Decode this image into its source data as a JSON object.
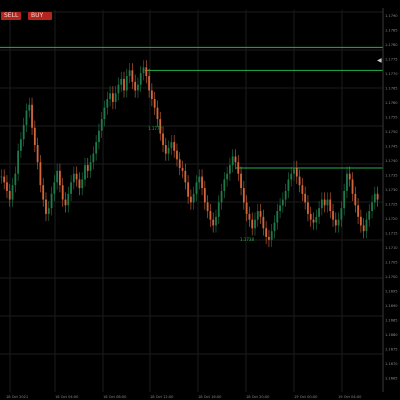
{
  "toolbar": {
    "sell_label": "SELL",
    "buy_label": "BUY"
  },
  "colors": {
    "background": "#000000",
    "grid": "#1b1b1b",
    "level_line": "#22b14c",
    "candle_up": "#1f7a4a",
    "candle_down": "#d4663a",
    "price_axis_text": "#8a8a8a",
    "button": "#b3261e"
  },
  "price_axis": {
    "ticks": [
      "1.1790",
      "1.1785",
      "1.1780",
      "1.1775",
      "1.1770",
      "1.1765",
      "1.1760",
      "1.1755",
      "1.1750",
      "1.1745",
      "1.1740",
      "1.1735",
      "1.1730",
      "1.1725",
      "1.1720",
      "1.1715",
      "1.1710",
      "1.1705",
      "1.1700",
      "1.1695",
      "1.1690",
      "1.1685",
      "1.1680",
      "1.1675",
      "1.1670",
      "1.1665"
    ],
    "current_price_marker": "◀"
  },
  "time_axis": {
    "ticks": [
      "18 Oct 2021",
      "18 Oct 04:00",
      "18 Oct 08:00",
      "18 Oct 12:00",
      "18 Oct 16:00",
      "18 Oct 20:00",
      "19 Oct 00:00",
      "19 Oct 04:00"
    ]
  },
  "level_labels": {
    "high_label": "1.1772",
    "mid_label": "1.1738"
  },
  "chart_data": {
    "type": "candlestick",
    "title": "",
    "xlabel": "",
    "ylabel": "",
    "ylim": [
      1.166,
      1.1793
    ],
    "grid": true,
    "closes": [
      1.1735,
      1.1733,
      1.173,
      1.1727,
      1.1732,
      1.1736,
      1.1744,
      1.1748,
      1.1753,
      1.1758,
      1.176,
      1.1752,
      1.1746,
      1.174,
      1.1732,
      1.1727,
      1.1722,
      1.1724,
      1.1729,
      1.1733,
      1.1737,
      1.1732,
      1.1727,
      1.1725,
      1.1729,
      1.1733,
      1.1736,
      1.1734,
      1.1731,
      1.1734,
      1.1739,
      1.1737,
      1.174,
      1.1743,
      1.1747,
      1.1751,
      1.1755,
      1.1759,
      1.1762,
      1.1764,
      1.1761,
      1.1764,
      1.1767,
      1.1769,
      1.1765,
      1.177,
      1.1772,
      1.1768,
      1.1765,
      1.1767,
      1.1771,
      1.1773,
      1.177,
      1.1765,
      1.1762,
      1.1759,
      1.1755,
      1.175,
      1.1746,
      1.1743,
      1.1745,
      1.1747,
      1.1744,
      1.1741,
      1.1738,
      1.1737,
      1.1733,
      1.1728,
      1.1726,
      1.1729,
      1.1733,
      1.1735,
      1.1731,
      1.1726,
      1.1723,
      1.172,
      1.1718,
      1.1721,
      1.1726,
      1.173,
      1.1734,
      1.1736,
      1.1739,
      1.1742,
      1.174,
      1.1736,
      1.1731,
      1.1726,
      1.1722,
      1.172,
      1.1717,
      1.172,
      1.1723,
      1.1721,
      1.1717,
      1.1714,
      1.1713,
      1.1716,
      1.1719,
      1.1723,
      1.1725,
      1.1727,
      1.173,
      1.1734,
      1.1736,
      1.1738,
      1.1735,
      1.1732,
      1.1729,
      1.1726,
      1.1722,
      1.172,
      1.1719,
      1.1721,
      1.1724,
      1.1727,
      1.1725,
      1.1727,
      1.1723,
      1.172,
      1.1718,
      1.172,
      1.1724,
      1.173,
      1.1736,
      1.1734,
      1.1729,
      1.1725,
      1.1721,
      1.1718,
      1.1716,
      1.172,
      1.1723,
      1.1726,
      1.1729,
      1.1727
    ],
    "horizontal_levels": [
      1.178,
      1.1772,
      1.1738
    ]
  }
}
